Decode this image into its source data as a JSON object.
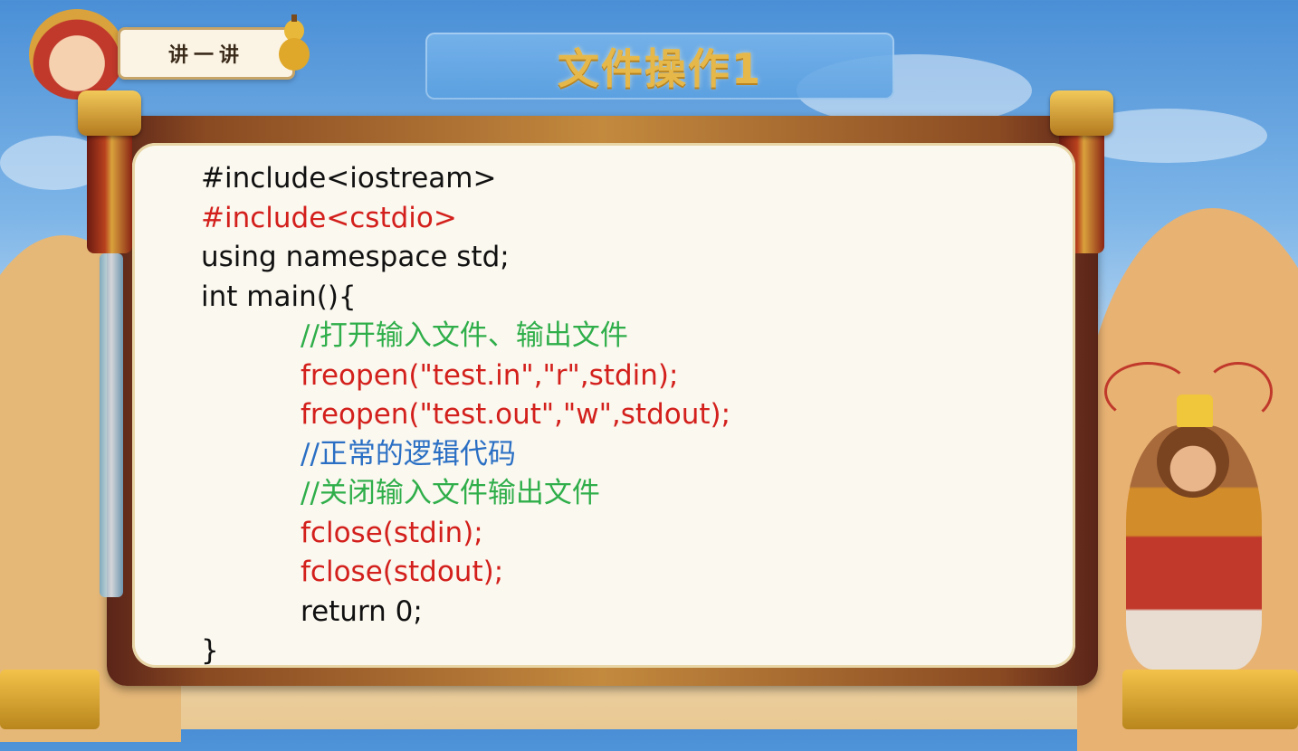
{
  "header": {
    "badge_label": "讲一讲",
    "slide_title": "文件操作1"
  },
  "code_lines": [
    {
      "text": "#include<iostream>",
      "color": "#111111",
      "indent": 0
    },
    {
      "text": "#include<cstdio>",
      "color": "#d3201c",
      "indent": 0
    },
    {
      "text": "using namespace std;",
      "color": "#111111",
      "indent": 0
    },
    {
      "text": "int main(){",
      "color": "#111111",
      "indent": 0
    },
    {
      "text": "//打开输入文件、输出文件",
      "color": "#2fae4a",
      "indent": 1
    },
    {
      "text": "freopen(\"test.in\",\"r\",stdin);",
      "color": "#d3201c",
      "indent": 1
    },
    {
      "text": "freopen(\"test.out\",\"w\",stdout);",
      "color": "#d3201c",
      "indent": 1
    },
    {
      "text": "//正常的逻辑代码",
      "color": "#2a6fc4",
      "indent": 1
    },
    {
      "text": "//关闭输入文件输出文件",
      "color": "#2fae4a",
      "indent": 1
    },
    {
      "text": "fclose(stdin);",
      "color": "#d3201c",
      "indent": 1
    },
    {
      "text": "fclose(stdout);",
      "color": "#d3201c",
      "indent": 1
    },
    {
      "text": "return 0;",
      "color": "#111111",
      "indent": 1
    },
    {
      "text": "}",
      "color": "#111111",
      "indent": 0
    }
  ],
  "decor": {
    "left_character_icon": "monk-character-icon",
    "right_character_icon": "monkey-king-character-icon",
    "gourd_icon": "gourd-icon",
    "sword_icon": "sword-icon"
  }
}
